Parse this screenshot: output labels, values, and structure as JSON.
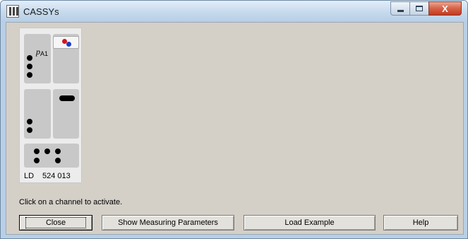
{
  "window": {
    "title": "CASSYs"
  },
  "caption": {
    "minimize": "",
    "maximize": "",
    "close": "X"
  },
  "cassy": {
    "sensor_label_main": "p",
    "sensor_label_sub": "A1",
    "model": "LD",
    "part_number": "524 013"
  },
  "status": "Click on a channel to activate.",
  "buttons": {
    "close": "Close",
    "show_params": "Show Measuring Parameters",
    "load_example": "Load Example",
    "help": "Help"
  }
}
